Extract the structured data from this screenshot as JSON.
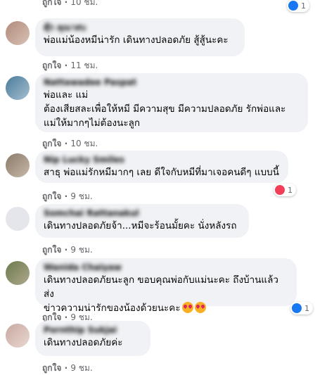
{
  "comments": [
    {
      "author": "ตุ๊ก คุณาสบ",
      "text": "พ่อแม่น้องหมีน่ารัก เดินทางปลอดภัย สู้สู้นะคะ",
      "like_label": "ถูกใจ",
      "time": "11 ชม."
    },
    {
      "author": "Nattawadee Paspat",
      "text": "พ่อและ แม่\nต้องเสียสละเพื่อให้หมี มีความสุข มีความปลอดภัย รักพ่อและ\nแม่ให้มากๆไม่ต้องนะลูก",
      "like_label": "ถูกใจ",
      "time": "10 ชม."
    },
    {
      "author": "Nip Lucky Smiles",
      "text": "สาธุ พ่อแม่รักหมีมากๆ เลย ดีใจกับหมีที่มาเจอคนดีๆ แบบนี้",
      "like_label": "ถูกใจ",
      "time": "9 ชม.",
      "reaction": {
        "type": "love",
        "count": "1"
      }
    },
    {
      "author": "Somchai Rattanakul",
      "text": "เดินทางปลอดภัยจ้า...หมีจะร้อนมั้ยคะ นั่งหลังรถ",
      "like_label": "ถูกใจ",
      "time": "9 ชม."
    },
    {
      "author": "Wanida Chaiyaw",
      "text": "เดินทางปลอดภัยนะลูก ขอบคุณพ่อกับแม่นะคะ ถึงบ้านแล้วส่ง\nข่าวความน่ารักของน้องด้วยนะคะ",
      "like_label": "ถูกใจ",
      "time": "9 ชม.",
      "emojis": [
        "heart-eyes",
        "heart-eyes"
      ],
      "reaction": {
        "type": "like",
        "count": "1"
      }
    },
    {
      "author": "Pornthip Sukjai",
      "text": "เดินทางปลอดภัยค่ะ",
      "like_label": "ถูกใจ",
      "time": "9 ชม."
    }
  ],
  "top_reaction": {
    "type": "like",
    "count": "1"
  },
  "top_like_label": "ถูกใจ",
  "top_time": "10 ชม.",
  "colors": {
    "bubble": "#f0f2f5",
    "meta": "#65676b",
    "like": "#1877f2",
    "love": "#f33e58"
  }
}
